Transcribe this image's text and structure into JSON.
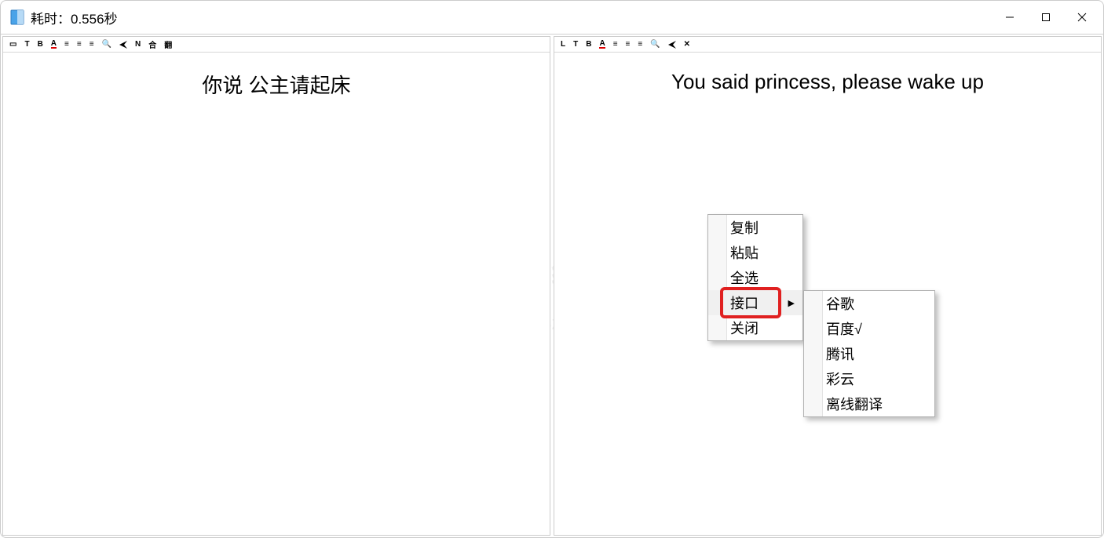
{
  "window": {
    "title": "耗时：0.556秒"
  },
  "left_pane": {
    "toolbar_icons": [
      "□",
      "T",
      "B",
      "A",
      "≣",
      "≣",
      "≣",
      "🔍",
      "✈",
      "N",
      "合",
      "翻"
    ],
    "text": "你说 公主请起床"
  },
  "right_pane": {
    "toolbar_icons": [
      "L",
      "T",
      "B",
      "A",
      "≣",
      "≣",
      "≣",
      "🔍",
      "✈",
      "✕"
    ],
    "text": "You said princess, please wake up"
  },
  "watermark": {
    "text": "i3综合社区",
    "url": "www.i3zh.com"
  },
  "context_menu": {
    "items": [
      {
        "label": "复制",
        "submenu": false
      },
      {
        "label": "粘贴",
        "submenu": false
      },
      {
        "label": "全选",
        "submenu": false
      },
      {
        "label": "接口",
        "submenu": true,
        "highlighted": true
      },
      {
        "label": "关闭",
        "submenu": false
      }
    ]
  },
  "submenu": {
    "items": [
      "谷歌",
      "百度√",
      "腾讯",
      "彩云",
      "离线翻译"
    ]
  }
}
